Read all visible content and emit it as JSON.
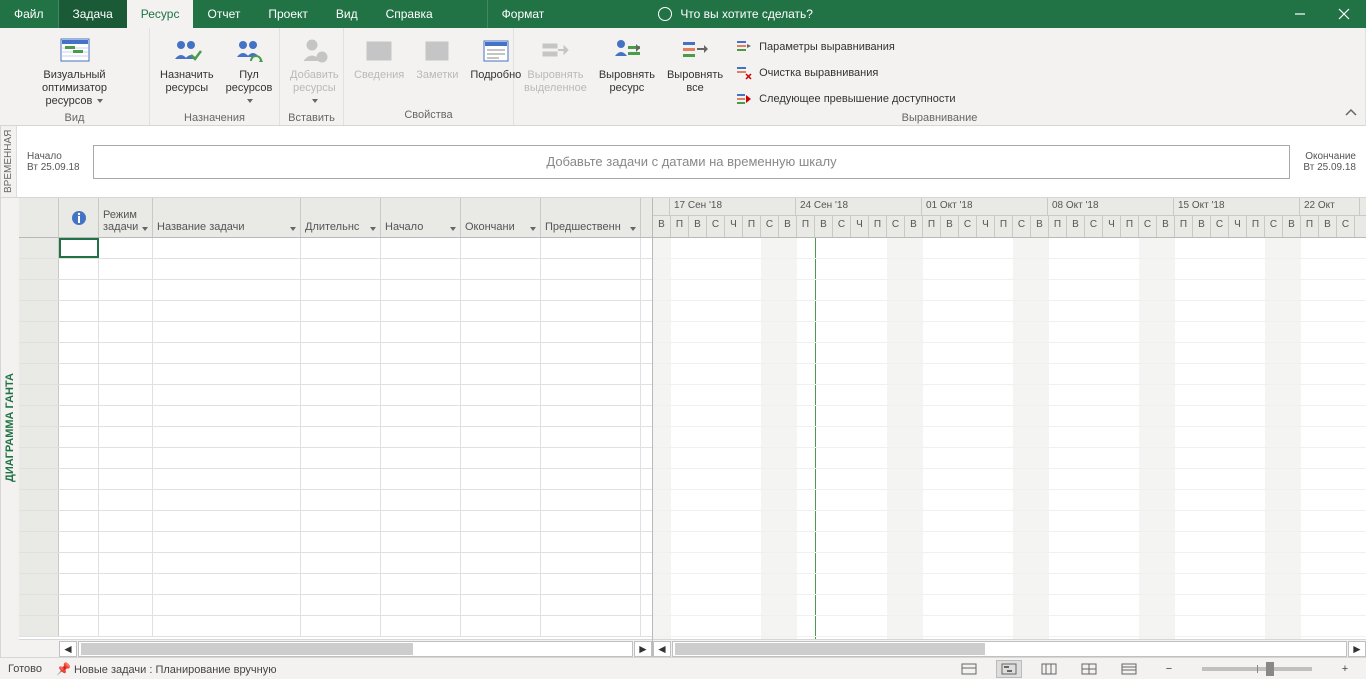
{
  "tabs": {
    "file": "Файл",
    "task": "Задача",
    "resource": "Ресурс",
    "report": "Отчет",
    "project": "Проект",
    "view": "Вид",
    "help": "Справка",
    "format": "Формат"
  },
  "tellme_placeholder": "Что вы хотите сделать?",
  "ribbon": {
    "view_group": "Вид",
    "visual_optimizer": "Визуальный оптимизатор\nресурсов",
    "assign_group": "Назначения",
    "assign_resources": "Назначить\nресурсы",
    "resource_pool": "Пул\nресурсов",
    "insert_group": "Вставить",
    "add_resources": "Добавить\nресурсы",
    "properties_group": "Свойства",
    "information": "Сведения",
    "notes": "Заметки",
    "details": "Подробно",
    "level_group": "Выравнивание",
    "level_selection": "Выровнять\nвыделенное",
    "level_resource": "Выровнять\nресурс",
    "level_all": "Выровнять\nвсе",
    "leveling_options": "Параметры выравнивания",
    "clear_leveling": "Очистка выравнивания",
    "next_overallocation": "Следующее превышение доступности"
  },
  "timeline": {
    "vlabel": "ВРЕМЕННАЯ",
    "start_label": "Начало",
    "start_date": "Вт 25.09.18",
    "end_label": "Окончание",
    "end_date": "Вт 25.09.18",
    "placeholder": "Добавьте задачи с датами на временную шкалу"
  },
  "gantt_vlabel": "ДИАГРАММА ГАНТА",
  "grid": {
    "mode": "Режим задачи",
    "name": "Название задачи",
    "duration": "Длительнс",
    "start": "Начало",
    "end": "Окончани",
    "pred": "Предшественн"
  },
  "gantt": {
    "weeks": [
      "",
      "17 Сен '18",
      "24 Сен '18",
      "01 Окт '18",
      "08 Окт '18",
      "15 Окт '18",
      "22 Окт"
    ],
    "week_widths": [
      17,
      126,
      126,
      126,
      126,
      126,
      60
    ],
    "days": [
      "В",
      "П",
      "В",
      "С",
      "Ч",
      "П",
      "С",
      "В",
      "П",
      "В",
      "С",
      "Ч",
      "П",
      "С",
      "В",
      "П",
      "В",
      "С",
      "Ч",
      "П",
      "С",
      "В",
      "П",
      "В",
      "С",
      "Ч",
      "П",
      "С",
      "В",
      "П",
      "В",
      "С",
      "Ч",
      "П",
      "С",
      "В",
      "П",
      "В",
      "С"
    ],
    "day_width": 18
  },
  "status": {
    "ready": "Готово",
    "new_tasks": "Новые задачи : Планирование вручную"
  }
}
